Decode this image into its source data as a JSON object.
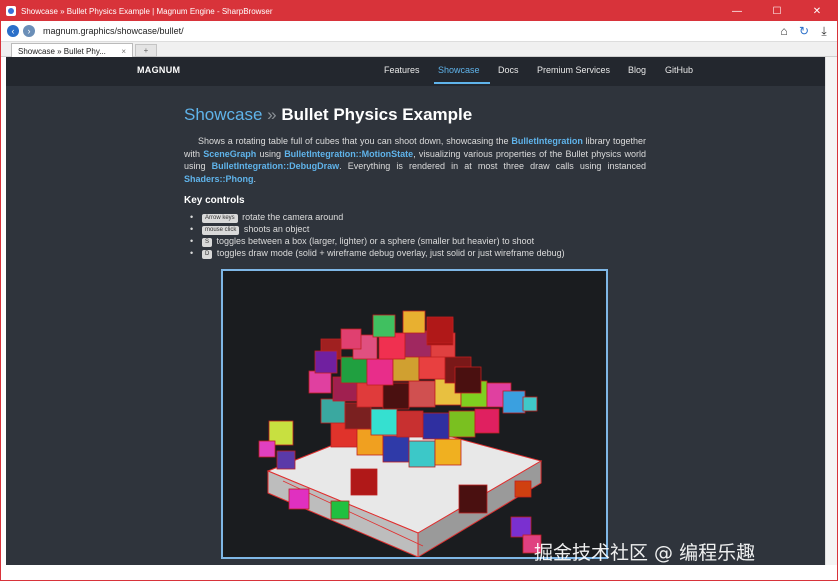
{
  "window": {
    "title": "Showcase » Bullet Physics Example | Magnum Engine - SharpBrowser",
    "controls": {
      "minimize": "—",
      "maximize": "☐",
      "close": "✕"
    }
  },
  "addressbar": {
    "back_icon": "back-arrow-icon",
    "forward_icon": "forward-arrow-icon",
    "url": "magnum.graphics/showcase/bullet/",
    "tools": {
      "home": "⌂",
      "refresh": "↻",
      "download": "⤓"
    }
  },
  "tabs": [
    {
      "label": "Showcase » Bullet Phy...",
      "close": "×"
    }
  ],
  "newtab": {
    "label": "+"
  },
  "site": {
    "brand": "MAGNUM",
    "nav": [
      {
        "label": "Features",
        "active": false
      },
      {
        "label": "Showcase",
        "active": true
      },
      {
        "label": "Docs",
        "active": false
      },
      {
        "label": "Premium Services",
        "active": false
      },
      {
        "label": "Blog",
        "active": false
      },
      {
        "label": "GitHub",
        "active": false
      }
    ]
  },
  "page": {
    "breadcrumb": "Showcase",
    "separator": "»",
    "title": "Bullet Physics Example",
    "intro": {
      "t1": "Shows a rotating table full of cubes that you can shoot down, showcasing the ",
      "c1": "BulletIntegration",
      "t2": " library together with ",
      "c2": "SceneGraph",
      "t3": " using ",
      "c3": "BulletIntegration::MotionState",
      "t4": ", visualizing various properties of the Bullet physics world using ",
      "c4": "BulletIntegration::DebugDraw",
      "t5": ". Everything is rendered in at most three draw calls using instanced ",
      "c5": "Shaders::Phong",
      "t6": "."
    },
    "key_controls_heading": "Key controls",
    "controls": [
      {
        "bullet": "•",
        "key": "Arrow keys",
        "text": " rotate the camera around"
      },
      {
        "bullet": "•",
        "key": "mouse click",
        "text": " shoots an object"
      },
      {
        "bullet": "•",
        "key": "S",
        "text": " toggles between a box (larger, lighter) or a sphere (smaller but heavier) to shoot"
      },
      {
        "bullet": "•",
        "key": "D",
        "text": " toggles draw mode (solid + wireframe debug overlay, just solid or just wireframe debug)"
      }
    ]
  },
  "watermark": "掘金技术社区 @ 编程乐趣",
  "colors": {
    "titlebar": "#d8333a",
    "page_bg": "#2f343c",
    "nav_bg": "#23272e",
    "accent": "#5fb3ea",
    "demo_border": "#7fb7e6"
  }
}
